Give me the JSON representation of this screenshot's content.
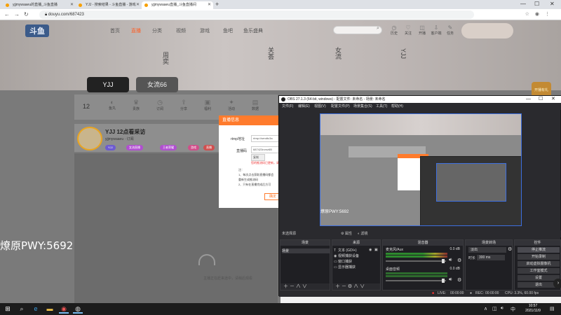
{
  "browser": {
    "tabs": [
      {
        "label": "yjjmywaaeu的直播_斗鱼直播",
        "active": false
      },
      {
        "label": "YJJ - 搜索结果 - 斗鱼直播 - 游戏",
        "active": false
      },
      {
        "label": "yjjmywaaeu直播_斗鱼直播间",
        "active": true
      }
    ],
    "url": "douyu.com/687423"
  },
  "site": {
    "nav": [
      "首页",
      "直播",
      "分类",
      "视频",
      "游戏",
      "鱼吧",
      "鱼乐盛典"
    ],
    "search_placeholder": "",
    "top_icons": [
      "历史",
      "关注",
      "开播",
      "客户端",
      "任务"
    ],
    "banner_names": [
      "周奕",
      "关荟",
      "女流",
      "YJJ"
    ],
    "promo": "开播有礼"
  },
  "room": {
    "tab1": "YJJ",
    "tab2": "女流66",
    "level_num": "12",
    "strip_icons": [
      "鱼丸",
      "贵族",
      "订阅",
      "分享",
      "福利",
      "活动",
      "数据"
    ],
    "title": "YJJ 12点看采访",
    "meta": "yjjmywaaeu · 订阅",
    "tags": [
      "YJJ",
      "女流直播",
      "王者荣耀",
      "游戏",
      "直播"
    ],
    "loading_text": "主播正在赶来途中，请稍后观看",
    "overlay_text": "燎原PWY:5692"
  },
  "dialog": {
    "title": "直播信息",
    "rtmp_label": "rtmp地址",
    "rtmp_value": "rtmp://sendtc3a",
    "code_label": "直播码",
    "code_value": "687423rcmz6B",
    "button_small": "复制",
    "warning": "您的推流码已更新，请及时重设置",
    "notes": [
      "注：",
      "1、每次点击获取直播码都会",
      "重新生成推流码",
      "2、只有在直播完成后方可"
    ],
    "confirm": "确定"
  },
  "obs": {
    "title": "OBS 27.1.3 (64-bit, windows) - 配置文件: 未命名 - 场景: 未命名",
    "menu": [
      "文件(F)",
      "编辑(E)",
      "视图(V)",
      "配置文件(P)",
      "场景集合(S)",
      "工具(T)",
      "帮助(H)"
    ],
    "preview_text": "燎原PWY:5692",
    "scene_bar_label": "未选择源",
    "scene_bar_props": "属性",
    "scene_bar_filters": "滤镜",
    "panels": {
      "scenes": {
        "title": "场景",
        "items": [
          "场景"
        ]
      },
      "sources": {
        "title": "来源",
        "items": [
          {
            "icon": "T",
            "name": "文本 (GDI+)"
          },
          {
            "icon": "◉",
            "name": "视频捕获设备"
          },
          {
            "icon": "▭",
            "name": "窗口捕获"
          },
          {
            "icon": "▭",
            "name": "显示器捕获"
          }
        ]
      },
      "mixer": {
        "title": "混音器",
        "channels": [
          {
            "name": "麦克风/Aux",
            "db": "0.0 dB"
          },
          {
            "name": "桌面音频",
            "db": "0.0 dB"
          }
        ]
      },
      "transitions": {
        "title": "场景转场",
        "type": "淡出",
        "duration_label": "时长",
        "duration": "300 ms"
      },
      "controls": {
        "title": "控件",
        "buttons": [
          "停止推流",
          "开始录制",
          "启动虚拟摄像机",
          "工作室模式",
          "设置",
          "退出"
        ]
      }
    },
    "status": {
      "live_label": "LIVE:",
      "live_time": "00:00:00",
      "rec_label": "REC:",
      "rec_time": "00:00:00",
      "cpu": "CPU: 3.3%, 60.00 fps"
    }
  },
  "taskbar": {
    "clock_time": "10:57",
    "clock_date": "2021/11/9"
  },
  "colors": {
    "accent": "#ff7b2c",
    "obs_bg": "#2a2a2e",
    "selection_blue": "#3d6fe0"
  }
}
